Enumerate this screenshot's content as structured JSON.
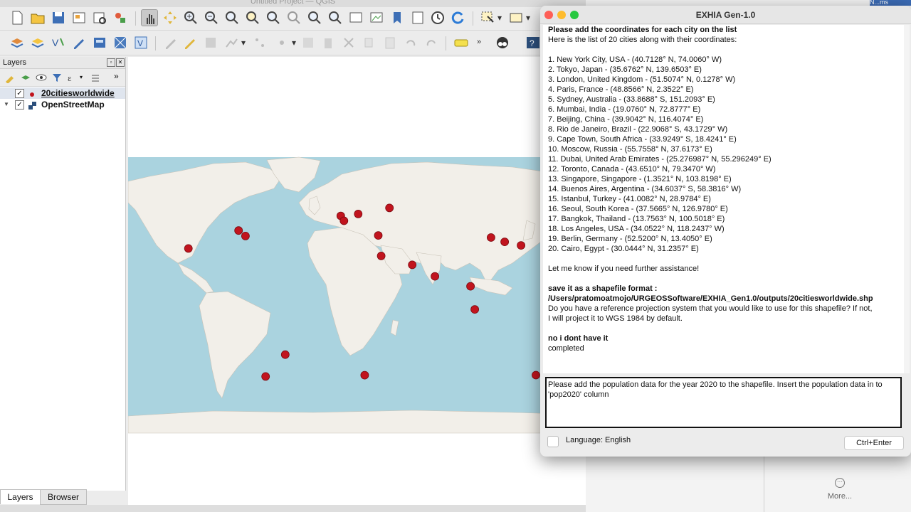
{
  "qgis": {
    "title": "Untitled Project — QGIS",
    "layers_panel": {
      "title": "Layers",
      "layers": [
        {
          "name": "20citiesworldwide",
          "checked": true,
          "selected": true
        },
        {
          "name": "OpenStreetMap",
          "checked": true,
          "selected": false
        }
      ]
    },
    "bottom_tabs": [
      "Layers",
      "Browser"
    ],
    "colors": {
      "ocean": "#aad3df",
      "land": "#f2efe9",
      "city": "#c1141e"
    },
    "map_points": [
      {
        "name": "New York City",
        "lat": 40.7128,
        "lon": -74.006
      },
      {
        "name": "Tokyo",
        "lat": 35.6762,
        "lon": 139.6503
      },
      {
        "name": "London",
        "lat": 51.5074,
        "lon": -0.1278
      },
      {
        "name": "Paris",
        "lat": 48.8566,
        "lon": 2.3522
      },
      {
        "name": "Sydney",
        "lat": -33.8688,
        "lon": 151.2093
      },
      {
        "name": "Mumbai",
        "lat": 19.076,
        "lon": 72.8777
      },
      {
        "name": "Beijing",
        "lat": 39.9042,
        "lon": 116.4074
      },
      {
        "name": "Rio de Janeiro",
        "lat": -22.9068,
        "lon": -43.1729
      },
      {
        "name": "Cape Town",
        "lat": -33.9249,
        "lon": 18.4241
      },
      {
        "name": "Moscow",
        "lat": 55.7558,
        "lon": 37.6173
      },
      {
        "name": "Dubai",
        "lat": 25.276987,
        "lon": 55.296249
      },
      {
        "name": "Toronto",
        "lat": 43.651,
        "lon": -79.347
      },
      {
        "name": "Singapore",
        "lat": 1.3521,
        "lon": 103.8198
      },
      {
        "name": "Buenos Aires",
        "lat": -34.6037,
        "lon": -58.3816
      },
      {
        "name": "Istanbul",
        "lat": 41.0082,
        "lon": 28.9784
      },
      {
        "name": "Seoul",
        "lat": 37.5665,
        "lon": 126.978
      },
      {
        "name": "Bangkok",
        "lat": 13.7563,
        "lon": 100.5018
      },
      {
        "name": "Los Angeles",
        "lat": 34.0522,
        "lon": -118.2437
      },
      {
        "name": "Berlin",
        "lat": 52.52,
        "lon": 13.405
      },
      {
        "name": "Cairo",
        "lat": 30.0444,
        "lon": 31.2357
      }
    ]
  },
  "background_app": {
    "top_badge": "N...ms",
    "more_label": "More..."
  },
  "exhia": {
    "title": "EXHIA Gen-1.0",
    "chat_lines": [
      {
        "text": "Please add the coordinates for each city on the list",
        "bold": true
      },
      {
        "text": "Here is the list of 20 cities along with their coordinates:",
        "bold": false
      },
      {
        "text": "",
        "bold": false
      },
      {
        "text": "1. New York City, USA - (40.7128° N, 74.0060° W)",
        "bold": false
      },
      {
        "text": "2. Tokyo, Japan - (35.6762° N, 139.6503° E)",
        "bold": false
      },
      {
        "text": "3. London, United Kingdom - (51.5074° N, 0.1278° W)",
        "bold": false
      },
      {
        "text": "4. Paris, France - (48.8566° N, 2.3522° E)",
        "bold": false
      },
      {
        "text": "5. Sydney, Australia - (33.8688° S, 151.2093° E)",
        "bold": false
      },
      {
        "text": "6. Mumbai, India - (19.0760° N, 72.8777° E)",
        "bold": false
      },
      {
        "text": "7. Beijing, China - (39.9042° N, 116.4074° E)",
        "bold": false
      },
      {
        "text": "8. Rio de Janeiro, Brazil - (22.9068° S, 43.1729° W)",
        "bold": false
      },
      {
        "text": "9. Cape Town, South Africa - (33.9249° S, 18.4241° E)",
        "bold": false
      },
      {
        "text": "10. Moscow, Russia - (55.7558° N, 37.6173° E)",
        "bold": false
      },
      {
        "text": "11. Dubai, United Arab Emirates - (25.276987° N, 55.296249° E)",
        "bold": false
      },
      {
        "text": "12. Toronto, Canada - (43.6510° N, 79.3470° W)",
        "bold": false
      },
      {
        "text": "13. Singapore, Singapore - (1.3521° N, 103.8198° E)",
        "bold": false
      },
      {
        "text": "14. Buenos Aires, Argentina - (34.6037° S, 58.3816° W)",
        "bold": false
      },
      {
        "text": "15. Istanbul, Turkey - (41.0082° N, 28.9784° E)",
        "bold": false
      },
      {
        "text": "16. Seoul, South Korea - (37.5665° N, 126.9780° E)",
        "bold": false
      },
      {
        "text": "17. Bangkok, Thailand - (13.7563° N, 100.5018° E)",
        "bold": false
      },
      {
        "text": "18. Los Angeles, USA - (34.0522° N, 118.2437° W)",
        "bold": false
      },
      {
        "text": "19. Berlin, Germany - (52.5200° N, 13.4050° E)",
        "bold": false
      },
      {
        "text": "20. Cairo, Egypt - (30.0444° N, 31.2357° E)",
        "bold": false
      },
      {
        "text": "",
        "bold": false
      },
      {
        "text": "Let me know if you need further assistance!",
        "bold": false
      },
      {
        "text": "",
        "bold": false
      },
      {
        "text": "save it as a shapefile format :",
        "bold": true
      },
      {
        "text": "/Users/pratomoatmojo/URGEOSSoftware/EXHIA_Gen1.0/outputs/20citiesworldwide.shp",
        "bold": true
      },
      {
        "text": "Do you have a reference projection system that you would like to use for this shapefile? If not,",
        "bold": false
      },
      {
        "text": "I will project it to WGS 1984 by default.",
        "bold": false
      },
      {
        "text": "",
        "bold": false
      },
      {
        "text": "no i dont have it",
        "bold": true
      },
      {
        "text": "completed",
        "bold": false
      }
    ],
    "prompt_value": "Please add the population data for the year 2020 to the shapefile. Insert the population data in to 'pop2020' column",
    "language_label": "Language: English",
    "send_label": "Ctrl+Enter"
  }
}
